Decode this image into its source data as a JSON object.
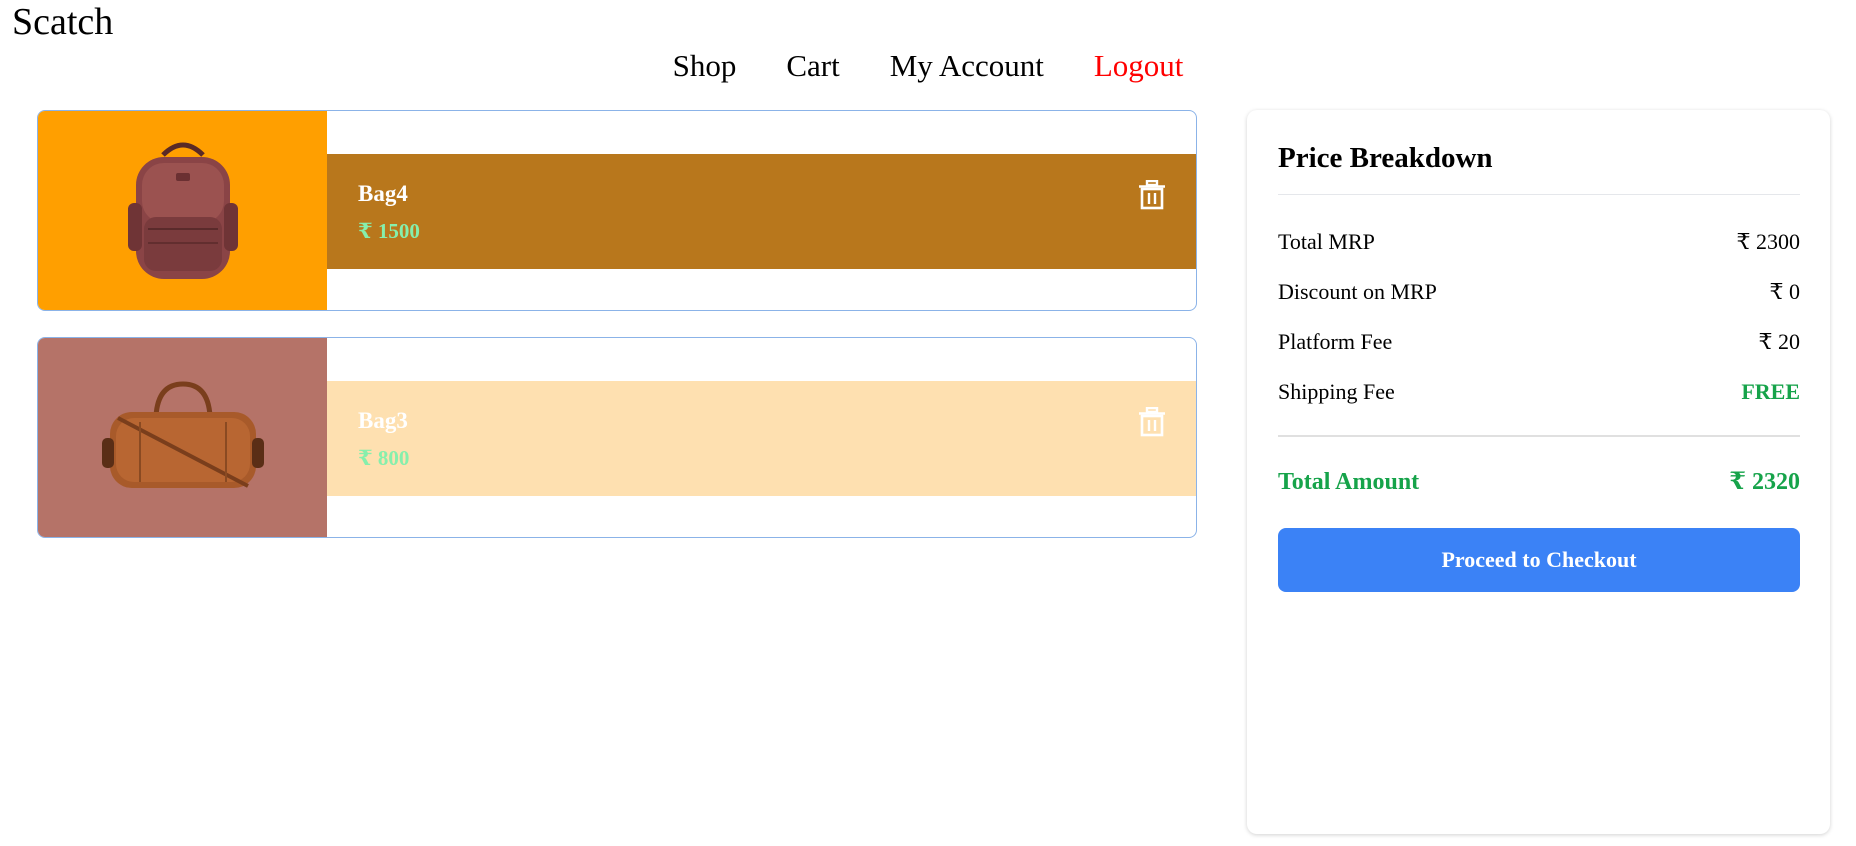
{
  "brand": "Scatch",
  "nav": {
    "shop": "Shop",
    "cart": "Cart",
    "account": "My Account",
    "logout": "Logout"
  },
  "items": [
    {
      "name": "Bag4",
      "price": "₹ 1500",
      "bg": "#ff9f00",
      "band": "#b8771c"
    },
    {
      "name": "Bag3",
      "price": "₹ 800",
      "bg": "#b57368",
      "band": "#fee0b0"
    }
  ],
  "summary": {
    "title": "Price Breakdown",
    "rows": [
      {
        "label": "Total MRP",
        "value": "₹ 2300"
      },
      {
        "label": "Discount on MRP",
        "value": "₹ 0"
      },
      {
        "label": "Platform Fee",
        "value": "₹ 20"
      },
      {
        "label": "Shipping Fee",
        "value": "FREE"
      }
    ],
    "total_label": "Total Amount",
    "total_value": "₹ 2320",
    "checkout_label": "Proceed to Checkout"
  },
  "colors": {
    "accent": "#3b82f6",
    "success": "#16a34a",
    "logout": "#ff0000",
    "price_text": "#86efac"
  },
  "icons": [
    "trash-icon",
    "backpack-image",
    "duffel-bag-image"
  ]
}
